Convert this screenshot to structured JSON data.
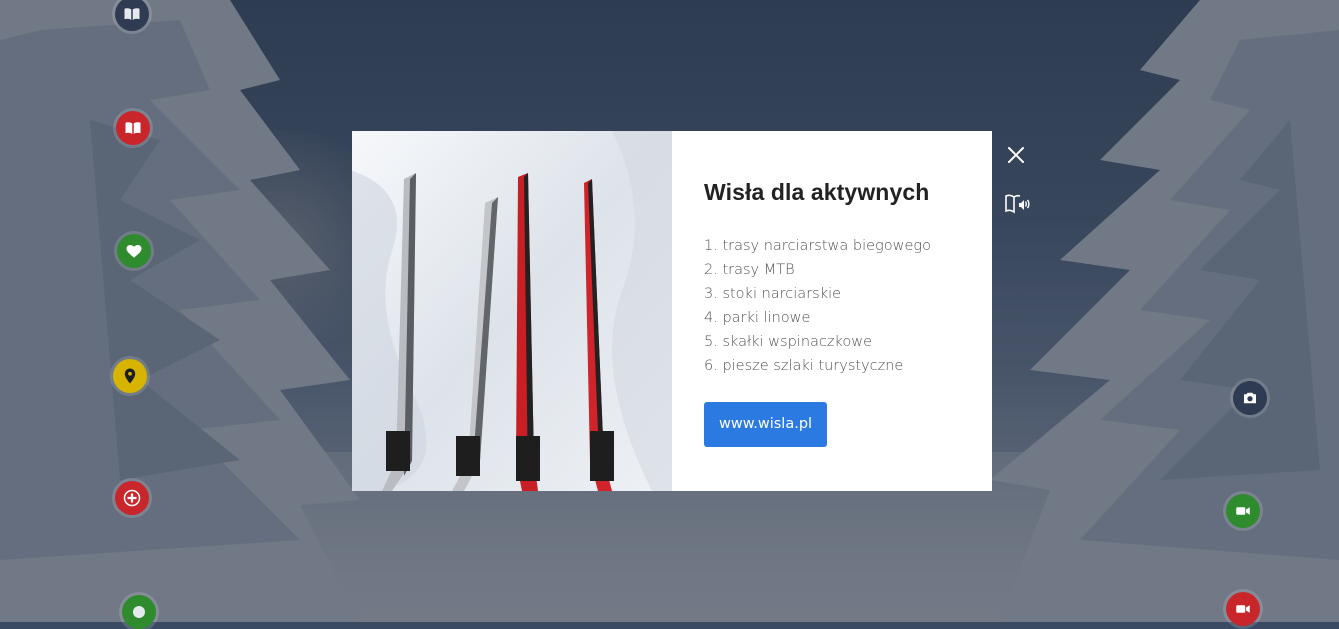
{
  "modal": {
    "title": "Wisła dla aktywnych",
    "items": [
      "1. trasy narciarstwa biegowego",
      "2. trasy MTB",
      "3. stoki narciarskie",
      "4. parki linowe",
      "5. skałki wspinaczkowe",
      "6. piesze szlaki turystyczne"
    ],
    "link_label": "www.wisla.pl"
  },
  "hotspots": {
    "book_top": "book-icon",
    "book_red": "book-icon",
    "heart_green": "heart-icon",
    "pin_yellow": "map-pin-icon",
    "plus_red": "plus-icon",
    "circle_green": "circle-icon",
    "camera_dark": "camera-icon",
    "video_green": "video-icon",
    "video_red": "video-icon"
  },
  "colors": {
    "accent": "#2a7ae2",
    "hotspot_red": "#c8262b",
    "hotspot_green": "#2e8b2e",
    "hotspot_yellow": "#d6b400",
    "hotspot_dark": "#2f3b52"
  }
}
